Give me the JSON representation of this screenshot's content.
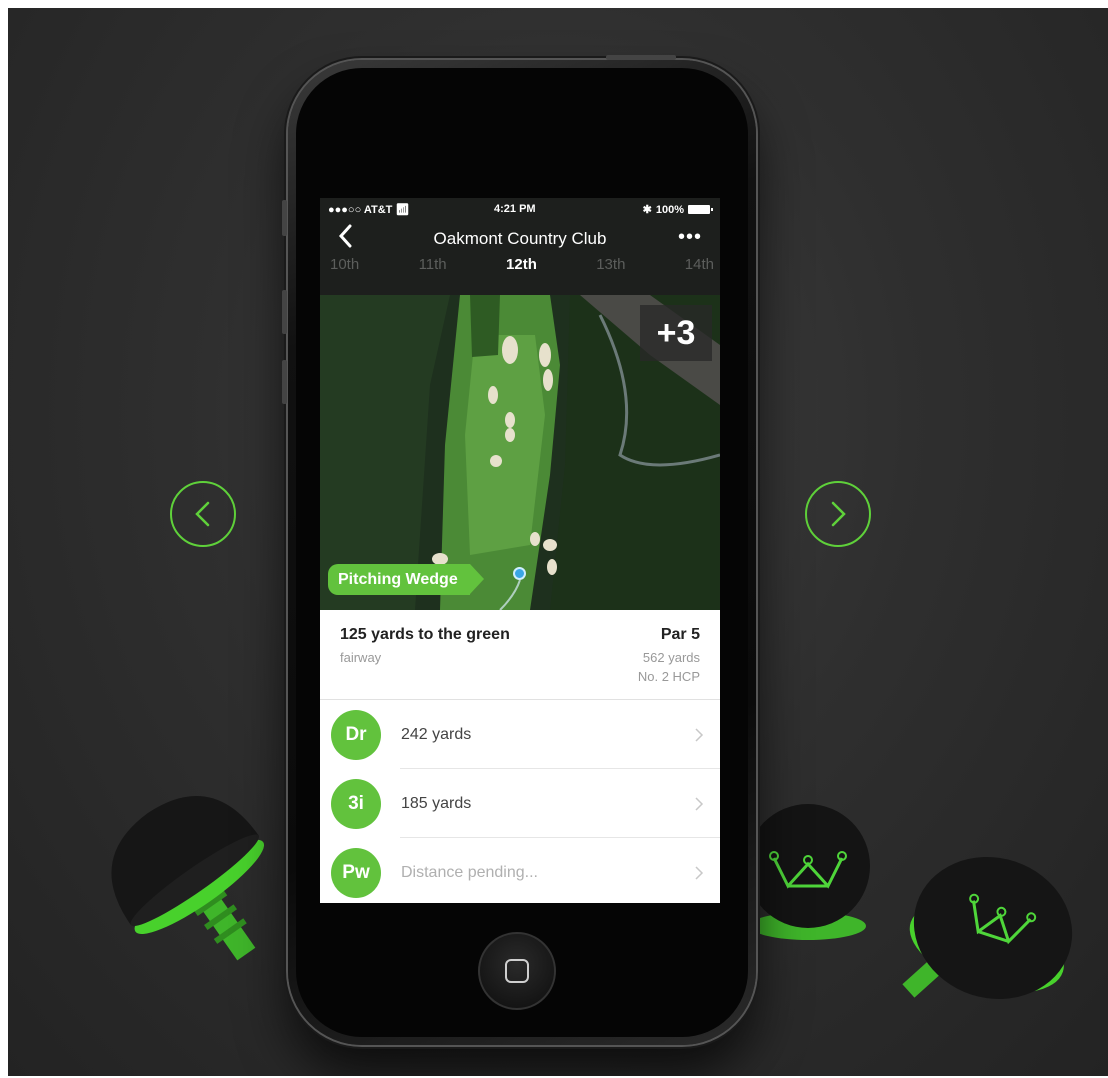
{
  "status_bar": {
    "carrier": "●●●○○ AT&T",
    "time": "4:21 PM",
    "battery": "100%"
  },
  "nav": {
    "title": "Oakmont Country Club",
    "back_icon": "chevron-left-icon",
    "more_label": "•••"
  },
  "holes": [
    "10th",
    "11th",
    "12th",
    "13th",
    "14th"
  ],
  "active_hole": "12th",
  "map": {
    "score": "+3",
    "club_tag": "Pitching Wedge"
  },
  "hole_info": {
    "distance": "125 yards to the green",
    "lie": "fairway",
    "par": "Par 5",
    "length": "562 yards",
    "handicap": "No. 2 HCP"
  },
  "shots": [
    {
      "club": "Dr",
      "text": "242 yards",
      "pending": false
    },
    {
      "club": "3i",
      "text": "185 yards",
      "pending": false
    },
    {
      "club": "Pw",
      "text": "Distance pending...",
      "pending": true
    }
  ],
  "colors": {
    "accent": "#62c23d",
    "arrow": "#5fd13a",
    "background": "#2f2f2f",
    "topbar": "#1d1f1d",
    "ball": "#3aa6e6"
  }
}
